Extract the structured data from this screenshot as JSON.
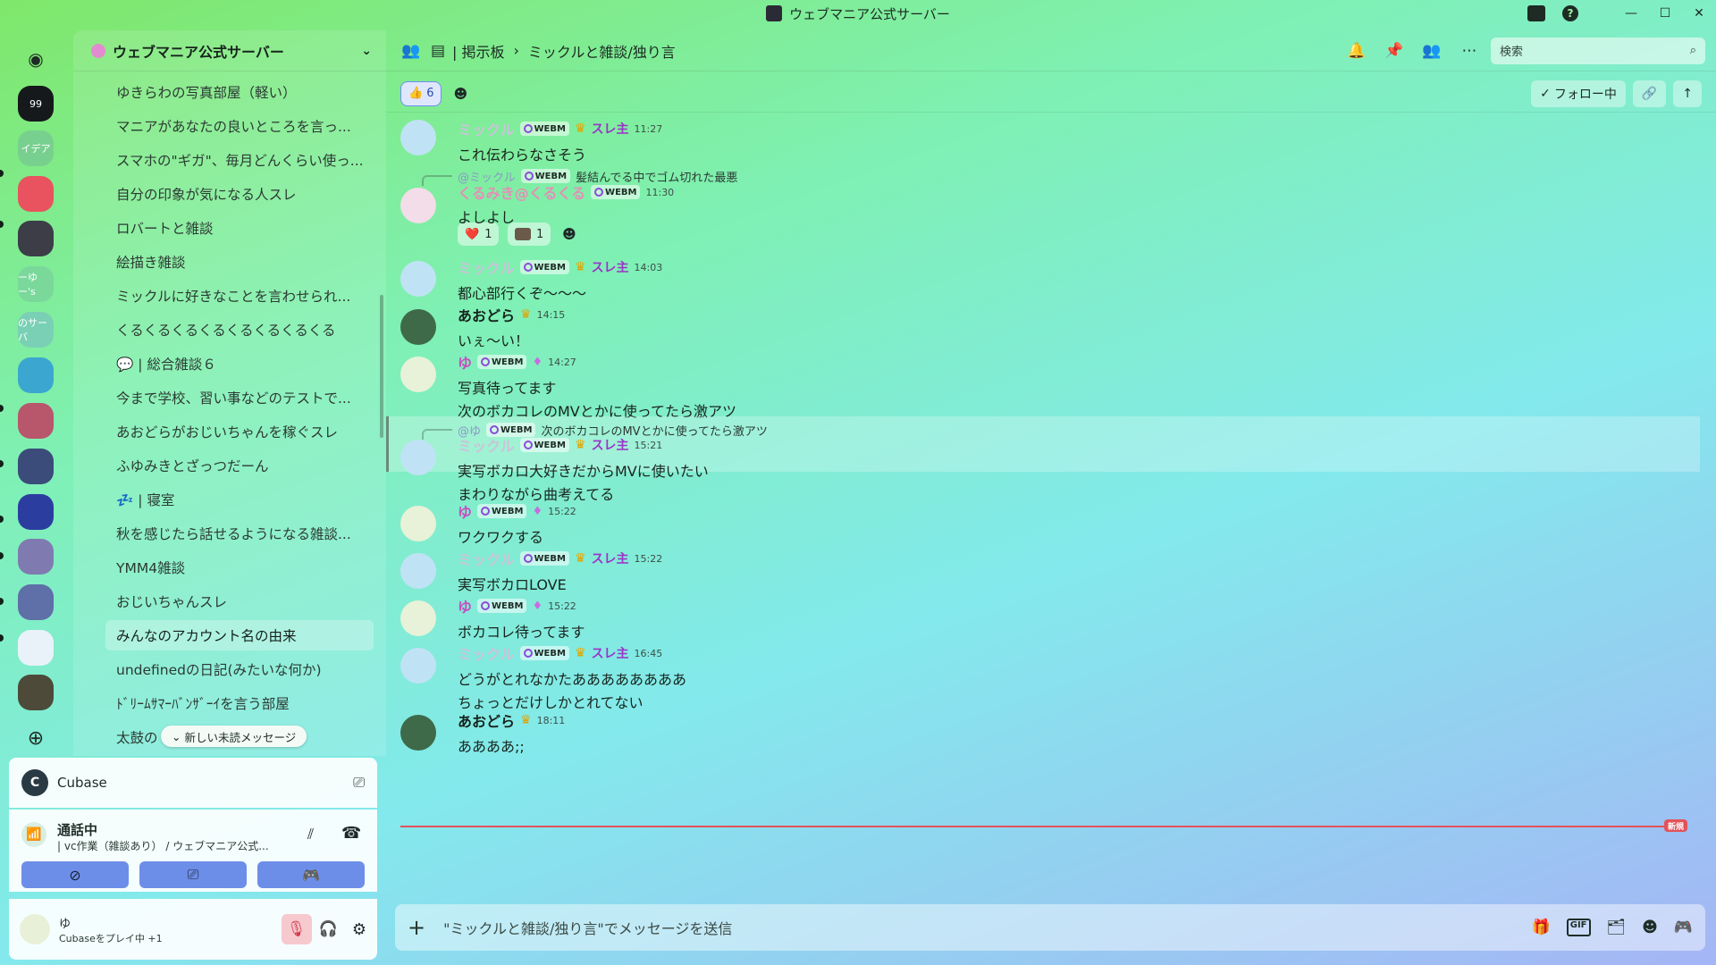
{
  "window": {
    "title": "ウェブマニア公式サーバー"
  },
  "rail": {
    "items": [
      {
        "name": "discord-home",
        "label": "",
        "color": "#2b3340"
      },
      {
        "name": "server-quote",
        "label": "99",
        "color": "#16191c"
      },
      {
        "name": "server-idea",
        "label": "イデア",
        "color": "#78d08f"
      },
      {
        "name": "server-discord",
        "label": "",
        "color": "#e8535f"
      },
      {
        "name": "server-anime",
        "label": "",
        "color": "#3d3d48"
      },
      {
        "name": "server-yu",
        "label": "ーゆー's",
        "color": "#7ad89a"
      },
      {
        "name": "server-saba",
        "label": "のサーバ",
        "color": "#7ad0b4"
      },
      {
        "name": "server-cat",
        "label": "",
        "color": "#3ba7d0"
      },
      {
        "name": "server-collage",
        "label": "",
        "color": "#b8566c"
      },
      {
        "name": "server-suit",
        "label": "",
        "color": "#3b4c7a"
      },
      {
        "name": "server-pixel",
        "label": "",
        "color": "#2b3ea0"
      },
      {
        "name": "server-manga",
        "label": "",
        "color": "#7f7bb0"
      },
      {
        "name": "server-anime2",
        "label": "",
        "color": "#5f6fa8"
      },
      {
        "name": "server-school",
        "label": "",
        "color": "#e9f2f8"
      },
      {
        "name": "server-glasses",
        "label": "",
        "color": "#4d4a3a"
      }
    ]
  },
  "sidebar": {
    "server_name": "ウェブマニア公式サーバー",
    "threads": [
      "ゆきらわの写真部屋（軽い）",
      "マニアがあなたの良いところを言っ...",
      "スマホの\"ギガ\"、毎月どんくらい使っ...",
      "自分の印象が気になる人スレ",
      "ロバートと雑談",
      "絵描き雑談",
      "ミックルに好きなことを言わせられ...",
      "くるくるくるくるくるくるくるくる",
      "💬 | 総合雑談６",
      "今まで学校、習い事などのテストで...",
      "あおどらがおじいちゃんを稼ぐスレ",
      "ふゆみきとざっつだーん",
      "💤 | 寝室",
      "秋を感じたら話せるようになる雑談...",
      "YMM4雑談",
      "おじいちゃんスレ",
      "みんなのアカウント名の由来",
      "undefinedの日記(みたいな何か)",
      "ﾄﾞﾘｰﾑｻﾏｰﾊﾞﾝｻﾞｰｲを言う部屋",
      "太鼓の"
    ],
    "selected_index": 16,
    "unread_pill": "新しい未読メッセージ"
  },
  "app_panel": {
    "name": "Cubase"
  },
  "voice": {
    "status": "通話中",
    "channel": "| vc作業（雑談あり） / ウェブマニア公式..."
  },
  "user": {
    "name": "ゆ",
    "activity": "Cubaseをプレイ中 +1"
  },
  "header": {
    "category": "| 掲示板",
    "separator": "›",
    "thread": "ミックルと雑談/独り言",
    "search_placeholder": "検索"
  },
  "subbar": {
    "reaction_count": "6",
    "follow_label": "フォロー中"
  },
  "tags": {
    "webm": "WEBM",
    "surenushi": "スレ主"
  },
  "messages": [
    {
      "author": "ミックル",
      "time": "11:27",
      "lines": [
        "これ伝わらなさそう"
      ]
    },
    {
      "reply_to": "@ミックル",
      "reply_text": "髪結んでる中でゴム切れた最悪",
      "author": "くるみき@くるくる",
      "time": "11:30",
      "lines": [
        "よしよし"
      ],
      "reactions": [
        {
          "emoji": "❤️",
          "count": "1"
        },
        {
          "emoji": "img",
          "count": "1"
        }
      ]
    },
    {
      "author": "ミックル",
      "time": "14:03",
      "lines": [
        "都心部行くぞ〜〜〜"
      ]
    },
    {
      "author": "あおどら",
      "time": "14:15",
      "lines": [
        "いぇ〜い！"
      ]
    },
    {
      "author": "ゆ",
      "time": "14:27",
      "lines": [
        "写真待ってます",
        "次のボカコレのMVとかに使ってたら激アツ"
      ]
    },
    {
      "reply_to": "@ゆ",
      "reply_text": "次のボカコレのMVとかに使ってたら激アツ",
      "author": "ミックル",
      "time": "15:21",
      "lines": [
        "実写ボカロ大好きだからMVに使いたい",
        "まわりながら曲考えてる"
      ]
    },
    {
      "author": "ゆ",
      "time": "15:22",
      "lines": [
        "ワクワクする"
      ]
    },
    {
      "author": "ミックル",
      "time": "15:22",
      "lines": [
        "実写ボカロLOVE"
      ]
    },
    {
      "author": "ゆ",
      "time": "15:22",
      "lines": [
        "ボカコレ待ってます"
      ]
    },
    {
      "author": "ミックル",
      "time": "16:45",
      "lines": [
        "どうがとれなかたああああああああ",
        "ちょっとだけしかとれてない"
      ]
    },
    {
      "author": "あおどら",
      "time": "18:11",
      "lines": [
        "ああああ;;"
      ]
    }
  ],
  "new_badge": "新規",
  "composer": {
    "placeholder": "\"ミックルと雑談/独り言\"でメッセージを送信",
    "gif_label": "GIF"
  },
  "colors": {
    "accent": "#6d8ee8",
    "new_line": "#e4525a",
    "surenushi": "#9b33c9"
  }
}
